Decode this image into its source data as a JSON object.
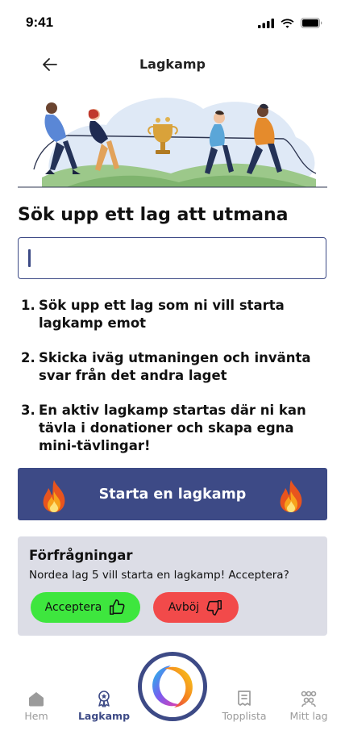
{
  "status": {
    "time": "9:41"
  },
  "header": {
    "title": "Lagkamp",
    "back_icon": "arrow-left-icon"
  },
  "hero": {
    "illustration": "tug-of-war-illustration"
  },
  "heading": "Sök upp ett lag att utmana",
  "search": {
    "value": "",
    "placeholder": ""
  },
  "steps": [
    {
      "num": "1.",
      "text": "Sök upp ett lag som ni vill starta lagkamp emot"
    },
    {
      "num": "2.",
      "text": "Skicka iväg utmaningen och invänta svar från det andra laget"
    },
    {
      "num": "3.",
      "text": "En aktiv lagkamp startas där ni kan tävla i donationer och skapa egna mini-tävlingar!"
    }
  ],
  "cta": {
    "label": "Starta en lagkamp",
    "icon": "fire-icon"
  },
  "requests": {
    "title": "Förfrågningar",
    "message": "Nordea lag 5 vill starta en lagkamp! Acceptera?",
    "accept_label": "Acceptera",
    "decline_label": "Avböj"
  },
  "tabs": [
    {
      "label": "Hem",
      "icon": "home-icon",
      "active": false
    },
    {
      "label": "Lagkamp",
      "icon": "medal-icon",
      "active": true
    },
    {
      "label": "Topplista",
      "icon": "receipt-icon",
      "active": false
    },
    {
      "label": "Mitt lag",
      "icon": "team-icon",
      "active": false
    }
  ],
  "colors": {
    "primary": "#3d4a86",
    "accept": "#3ee63e",
    "decline": "#f24a4a",
    "panel": "#dcdde6"
  }
}
